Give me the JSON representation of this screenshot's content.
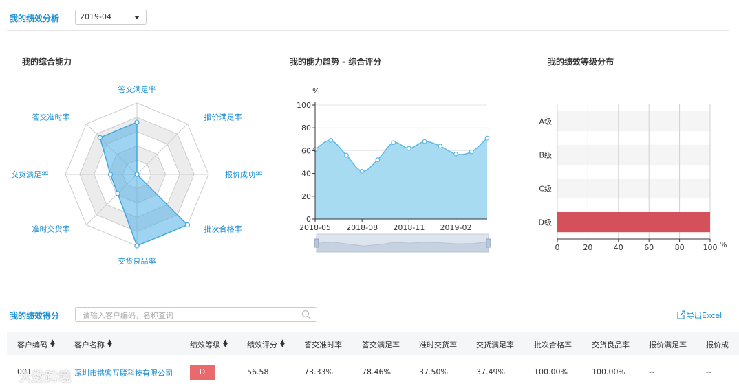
{
  "header": {
    "title": "我的绩效分析",
    "month_value": "2019-04"
  },
  "radar": {
    "title": "我的综合能力",
    "labels": [
      "答交满足率",
      "报价满足率",
      "报价成功率",
      "批次合格率",
      "交货良品率",
      "准时交货率",
      "交货满足率",
      "答交准时率"
    ],
    "values": [
      73,
      0,
      0,
      100,
      100,
      38,
      37,
      73
    ],
    "max": 100,
    "colors": {
      "line": "#3fa9e0",
      "fill": "rgba(79,175,230,0.55)",
      "ring_dark": "#ececec",
      "ring_light": "#ffffff",
      "axis": "#cccccc"
    }
  },
  "trend": {
    "title": "我的能力趋势 - 综合评分",
    "unit": "%",
    "chart_data": {
      "type": "area",
      "x": [
        "2018-05",
        "2018-06",
        "2018-07",
        "2018-08",
        "2018-09",
        "2018-10",
        "2018-11",
        "2018-12",
        "2019-01",
        "2019-02",
        "2019-03",
        "2019-04"
      ],
      "values": [
        61,
        69,
        56,
        42,
        52,
        67,
        62,
        68,
        64,
        57,
        59,
        71
      ],
      "x_tick_labels": [
        "2018-05",
        "2018-08",
        "2018-11",
        "2019-02"
      ],
      "y_ticks": [
        0,
        20,
        40,
        60,
        80,
        100
      ],
      "ylim": [
        0,
        100
      ],
      "ylabel": "%",
      "grid": true,
      "colors": {
        "fill": "#a6dbf2",
        "line": "#5fb8e2",
        "point": "#ffffff"
      }
    }
  },
  "grade": {
    "title": "我的绩效等级分布",
    "unit": "%",
    "chart_data": {
      "type": "bar",
      "orientation": "horizontal",
      "categories": [
        "A级",
        "B级",
        "C级",
        "D级"
      ],
      "values": [
        0,
        0,
        0,
        100
      ],
      "x_ticks": [
        0,
        20,
        40,
        60,
        80,
        100
      ],
      "xlim": [
        0,
        100
      ],
      "xlabel": "%",
      "grid": true,
      "colors": {
        "bar": "#d4505b",
        "band": "#f5f5f5"
      }
    }
  },
  "scores": {
    "title": "我的绩效得分",
    "search_placeholder": "请输入客户编码，名称查询",
    "export_label": "导出Excel",
    "columns": [
      "客户编码",
      "客户名称",
      "绩效等级",
      "绩效评分",
      "答交准时率",
      "答交满足率",
      "准时交货率",
      "交货满足率",
      "批次合格率",
      "交货良品率",
      "报价满足率",
      "报价成"
    ],
    "sortable": [
      true,
      true,
      true,
      true,
      false,
      false,
      false,
      false,
      false,
      false,
      false,
      false
    ],
    "row": {
      "code": "001",
      "name": "深圳市携客互联科技有限公司",
      "grade": "D",
      "score": "56.58",
      "ontime_reply": "73.33%",
      "reply_fill": "78.46%",
      "ontime_delivery": "37.50%",
      "delivery_fill": "37.49%",
      "batch_pass": "100.00%",
      "delivery_yield": "100.00%",
      "quote_fill": "--",
      "quote_success": "--"
    },
    "colors": {
      "link": "#1a8fd3",
      "badge": "#e96a6c"
    }
  },
  "watermark": "大数跨境"
}
